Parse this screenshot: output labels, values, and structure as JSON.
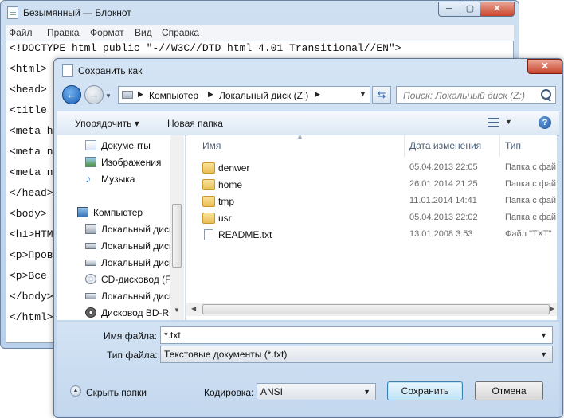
{
  "notepad": {
    "title": "Безымянный — Блокнот",
    "menu": [
      "Файл",
      "Правка",
      "Формат",
      "Вид",
      "Справка"
    ],
    "lines": [
      "<!DOCTYPE html public \"-//W3C//DTD html 4.01 Transitional//EN\">",
      "<html>",
      "<head>",
      "<title",
      "<meta h",
      "<meta n",
      "<meta n",
      "</head>",
      "<body>",
      "<h1>HTM",
      "<p>Пров",
      "<p>Все",
      "</body>",
      "</html>"
    ],
    "controls": {
      "minimize": "─",
      "maximize": "▢",
      "close": "✕"
    }
  },
  "dialog": {
    "title": "Сохранить как",
    "close": "✕",
    "nav": {
      "back": "←",
      "forward": "→",
      "history": "▼",
      "refresh": "⇆"
    },
    "address": {
      "crumbs": [
        "Компьютер",
        "Локальный диск (Z:)"
      ],
      "separator": "▶",
      "dropdown": "▼"
    },
    "search": {
      "placeholder": "Поиск: Локальный диск (Z:)"
    },
    "toolbar": {
      "organize": "Упорядочить ▾",
      "new_folder": "Новая папка",
      "view_dropdown": "▼",
      "help": "?"
    },
    "sidebar": [
      {
        "label": "Документы",
        "icon": "documents-icon"
      },
      {
        "label": "Изображения",
        "icon": "pictures-icon"
      },
      {
        "label": "Музыка",
        "icon": "music-icon"
      },
      {
        "label": "Компьютер",
        "icon": "computer-icon"
      },
      {
        "label": "Локальный диск",
        "icon": "drive-icon"
      },
      {
        "label": "Локальный диск",
        "icon": "drive-icon"
      },
      {
        "label": "Локальный диск",
        "icon": "drive-icon"
      },
      {
        "label": "CD-дисковод (F:",
        "icon": "cd-drive-icon"
      },
      {
        "label": "Локальный диск",
        "icon": "drive-icon"
      },
      {
        "label": "Дисковод BD-RC",
        "icon": "bd-drive-icon"
      }
    ],
    "columns": {
      "name": "Имя",
      "date": "Дата изменения",
      "type": "Тип"
    },
    "files": [
      {
        "name": "denwer",
        "date": "05.04.2013 22:05",
        "type": "Папка с фай",
        "kind": "folder"
      },
      {
        "name": "home",
        "date": "26.01.2014 21:25",
        "type": "Папка с фай",
        "kind": "folder"
      },
      {
        "name": "tmp",
        "date": "11.01.2014 14:41",
        "type": "Папка с фай",
        "kind": "folder"
      },
      {
        "name": "usr",
        "date": "05.04.2013 22:02",
        "type": "Папка с фай",
        "kind": "folder"
      },
      {
        "name": "README.txt",
        "date": "13.01.2008 3:53",
        "type": "Файл \"TXT\"",
        "kind": "file"
      }
    ],
    "filename": {
      "label": "Имя файла:",
      "value": "*.txt"
    },
    "filetype": {
      "label": "Тип файла:",
      "value": "Текстовые документы (*.txt)"
    },
    "hide_folders": "Скрыть папки",
    "encoding": {
      "label": "Кодировка:",
      "value": "ANSI"
    },
    "buttons": {
      "save": "Сохранить",
      "cancel": "Отмена"
    }
  },
  "colors": {
    "accent": "#3c7fb1",
    "folder": "#e9bf53",
    "chrome": "#c3d7ee"
  }
}
